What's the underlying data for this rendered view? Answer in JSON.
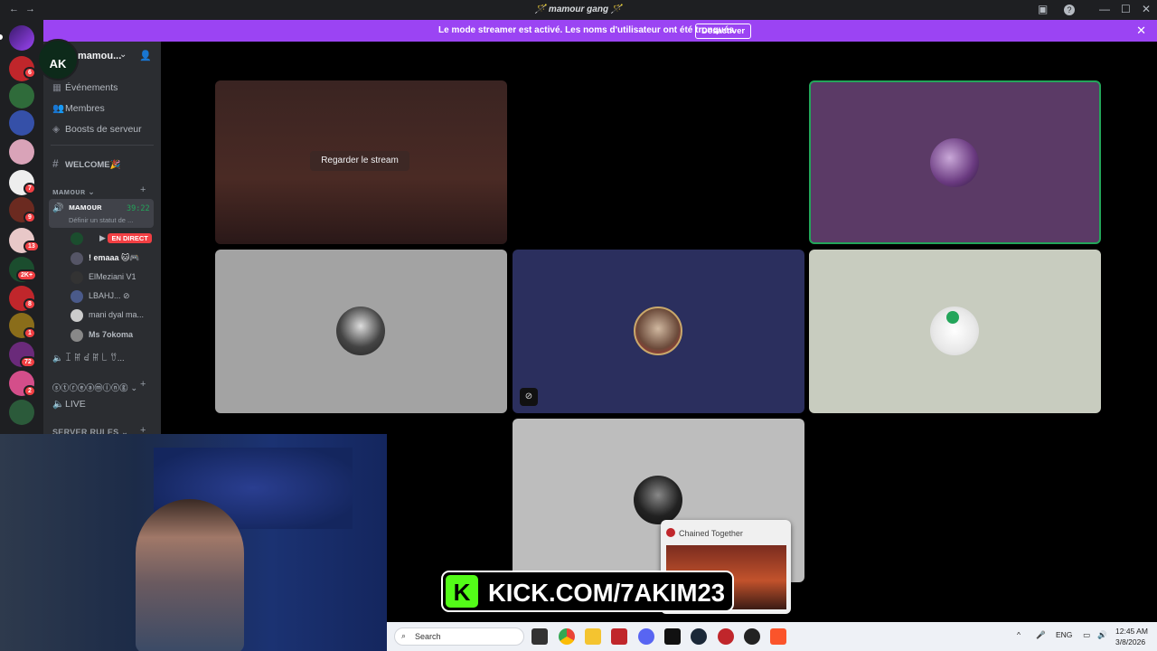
{
  "titlebar": {
    "title": "🪄 mamour gang 🪄",
    "back": "←",
    "forward": "→",
    "minimize": "—",
    "maximize": "☐",
    "close": "✕"
  },
  "banner": {
    "message": "Le mode streamer est activé. Les noms d'utilisateur ont été tronqués.",
    "button": "Désactiver",
    "close": "✕"
  },
  "servers": [
    {
      "badge": "6"
    },
    {
      "badge": ""
    },
    {
      "badge": ""
    },
    {
      "badge": ""
    },
    {
      "badge": "7"
    },
    {
      "badge": "9"
    },
    {
      "badge": "13"
    },
    {
      "badge": "2K+"
    },
    {
      "badge": "8"
    },
    {
      "badge": "1"
    },
    {
      "badge": "72"
    },
    {
      "badge": "2"
    },
    {
      "badge": ""
    }
  ],
  "sidebar": {
    "server_name": "mamou...",
    "logo_text": "AK",
    "items": [
      {
        "label": "Événements"
      },
      {
        "label": "Membres"
      },
      {
        "label": "Boosts de serveur"
      }
    ],
    "welcome_channel": "WELCOME🎉",
    "category1": "ᴍᴀᴍᴏᴜʀ",
    "voice_user": {
      "name": "ᴍᴀᴍᴏᴜʀ",
      "status": "Définir un statut de ...",
      "timer": "39:22"
    },
    "voice_members": [
      {
        "name": "",
        "badge": "EN DIRECT"
      },
      {
        "name": "! emaaa 🐱🎮"
      },
      {
        "name": "ElMeziani V1"
      },
      {
        "name": "LBAHJ..."
      },
      {
        "name": "mani dyal ma..."
      },
      {
        "name": "Ms 7okoma"
      }
    ],
    "channel_voice2": "ꀤ ꂵ ꀸ ꂵ ꒒ ꀎ...",
    "category2": "ⓢⓣⓡⓔⓐⓜⓘⓝⓖ",
    "channel_live": "LIVE",
    "category3": "SERVER RULES"
  },
  "grid": {
    "stream_button": "Regarder le stream"
  },
  "popup": {
    "title": "Chained Together"
  },
  "kick": {
    "text": "KICK.COM/7AKIM23",
    "logo": "K"
  },
  "taskbar": {
    "search_placeholder": "Search",
    "lang": "ENG",
    "time": "12:45 AM",
    "date": "3/8/2026"
  },
  "colors": {
    "banner": "#9b44f3",
    "discord_dark": "#1e1f22",
    "sidebar": "#2b2d31",
    "live_red": "#f23f43",
    "kick_green": "#53fc18"
  }
}
